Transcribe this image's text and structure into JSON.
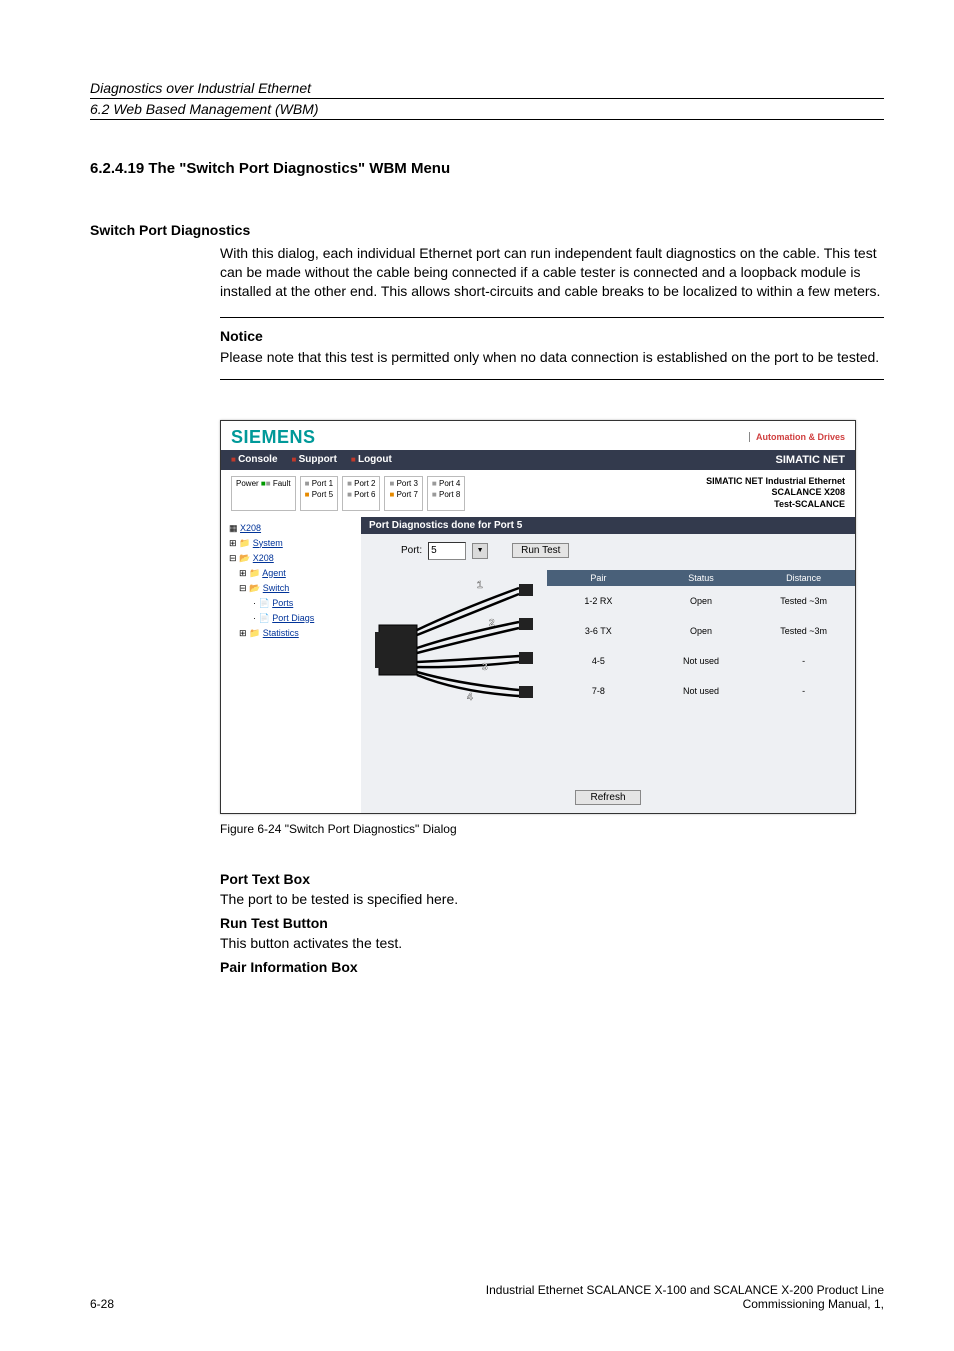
{
  "doc_header": {
    "line1": "Diagnostics over Industrial Ethernet",
    "line2": "6.2 Web Based Management (WBM)"
  },
  "section_heading": "6.2.4.19    The \"Switch Port Diagnostics\" WBM Menu",
  "subheading1": "Switch Port Diagnostics",
  "paragraph1": "With this dialog, each individual Ethernet port can run independent fault diagnostics on the cable. This test can be made without the cable being connected if a cable tester is connected and a loopback module is installed at the other end. This allows short-circuits and cable breaks to be localized to within a few meters.",
  "notice": {
    "title": "Notice",
    "text": "Please note that this test is permitted only when no data connection is established on the port to be tested."
  },
  "figure_caption": "Figure 6-24     \"Switch Port Diagnostics\" Dialog",
  "port_text_box": {
    "title": "Port Text Box",
    "text": "The port to be tested is specified here."
  },
  "run_test_button": {
    "title": "Run Test Button",
    "text": "This button activates the test."
  },
  "pair_info_box": {
    "title": "Pair Information Box"
  },
  "footer": {
    "page": "6-28",
    "right_line1": "Industrial Ethernet SCALANCE X-100 and SCALANCE X-200 Product Line",
    "right_line2": "Commissioning Manual, 1,"
  },
  "screenshot": {
    "logo": "SIEMENS",
    "aut_drives": "Automation & Drives",
    "menu": {
      "console": "Console",
      "support": "Support",
      "logout": "Logout"
    },
    "simatic_net": "SIMATIC NET",
    "port_status": {
      "col0": {
        "r1": "Power",
        "r2": ""
      },
      "col0b": {
        "r1": "Fault",
        "r2": ""
      },
      "col1": {
        "r1": "Port 1",
        "r2": "Port 5"
      },
      "col2": {
        "r1": "Port 2",
        "r2": "Port 6"
      },
      "col3": {
        "r1": "Port 3",
        "r2": "Port 7"
      },
      "col4": {
        "r1": "Port 4",
        "r2": "Port 8"
      }
    },
    "info_right": {
      "l1": "SIMATIC NET Industrial Ethernet",
      "l2": "SCALANCE X208",
      "l3": "Test-SCALANCE"
    },
    "tree": {
      "root": "X208",
      "system": "System",
      "x208": "X208",
      "agent": "Agent",
      "switch": "Switch",
      "ports": "Ports",
      "port_diags": "Port Diags",
      "statistics": "Statistics"
    },
    "title_bar": "Port Diagnostics done for Port 5",
    "controls": {
      "port_label": "Port:",
      "port_value": "5",
      "run_test": "Run Test"
    },
    "diag_table": {
      "head": {
        "pair": "Pair",
        "status": "Status",
        "distance": "Distance"
      },
      "rows": [
        {
          "pair": "1-2 RX",
          "status": "Open",
          "distance": "Tested ~3m"
        },
        {
          "pair": "3-6 TX",
          "status": "Open",
          "distance": "Tested ~3m"
        },
        {
          "pair": "4-5",
          "status": "Not used",
          "distance": "-"
        },
        {
          "pair": "7-8",
          "status": "Not used",
          "distance": "-"
        }
      ]
    },
    "diagram_labels": {
      "n1": "1",
      "n2": "2",
      "n3": "3",
      "n4": "4"
    },
    "refresh": "Refresh"
  }
}
